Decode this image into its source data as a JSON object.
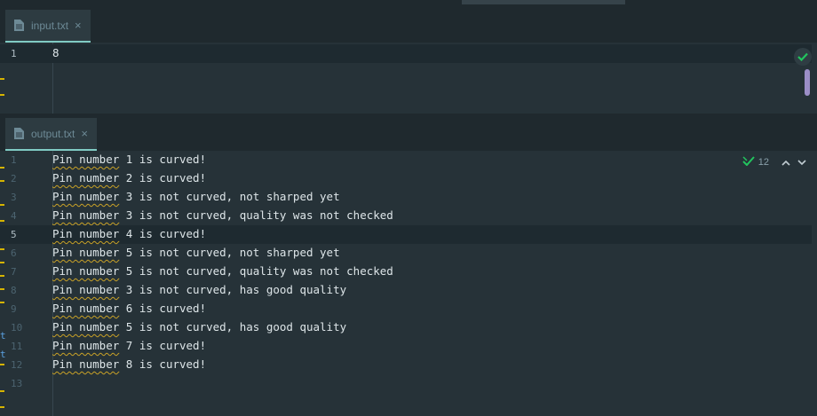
{
  "input_tab": {
    "title": "input.txt",
    "close": "×"
  },
  "output_tab": {
    "title": "output.txt",
    "close": "×"
  },
  "input_editor": {
    "lines": [
      {
        "number": "1",
        "text": "8"
      }
    ]
  },
  "output_editor": {
    "inspection_count": "12",
    "lines": [
      {
        "number": "1",
        "prefix": "Pin number",
        "rest": " 1 is curved!"
      },
      {
        "number": "2",
        "prefix": "Pin number",
        "rest": " 2 is curved!"
      },
      {
        "number": "3",
        "prefix": "Pin number",
        "rest": " 3 is not curved, not sharped yet"
      },
      {
        "number": "4",
        "prefix": "Pin number",
        "rest": " 3 is not curved, quality was not checked"
      },
      {
        "number": "5",
        "prefix": "Pin number",
        "rest": " 4 is curved!"
      },
      {
        "number": "6",
        "prefix": "Pin number",
        "rest": " 5 is not curved, not sharped yet"
      },
      {
        "number": "7",
        "prefix": "Pin number",
        "rest": " 5 is not curved, quality was not checked"
      },
      {
        "number": "8",
        "prefix": "Pin number",
        "rest": " 3 is not curved, has good quality"
      },
      {
        "number": "9",
        "prefix": "Pin number",
        "rest": " 6 is curved!"
      },
      {
        "number": "10",
        "prefix": "Pin number",
        "rest": " 5 is not curved, has good quality"
      },
      {
        "number": "11",
        "prefix": "Pin number",
        "rest": " 7 is curved!"
      },
      {
        "number": "12",
        "prefix": "Pin number",
        "rest": " 8 is curved!"
      },
      {
        "number": "13",
        "prefix": "",
        "rest": ""
      }
    ]
  },
  "left_edge_glyphs": [
    "t",
    "t"
  ],
  "colors": {
    "background": "#263238",
    "accent": "#80cbc4",
    "check": "#22c55e",
    "squiggle": "#c9a227"
  },
  "icons": {
    "file": "file-icon",
    "close": "close-icon",
    "check": "check-icon",
    "up": "chevron-up-icon",
    "down": "chevron-down-icon"
  }
}
